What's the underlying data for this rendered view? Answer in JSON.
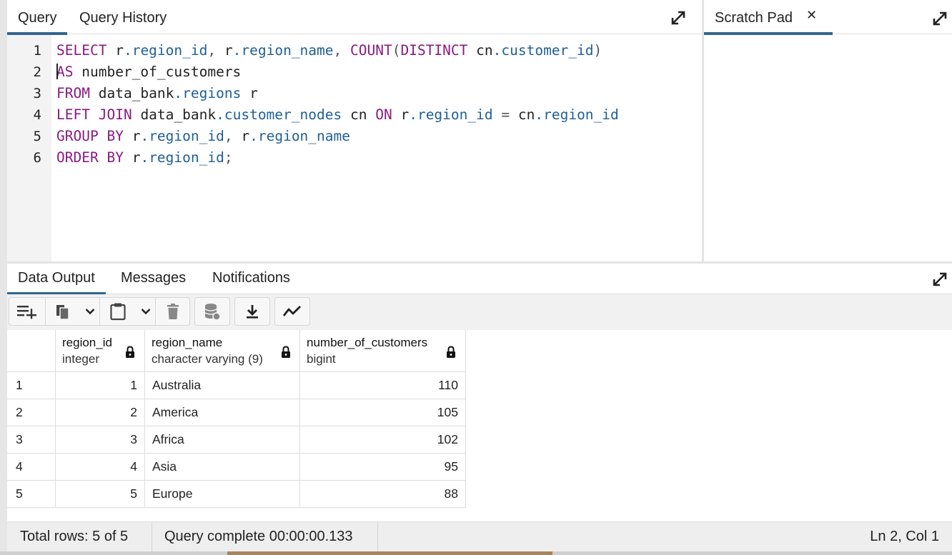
{
  "query_panel": {
    "tabs": [
      {
        "label": "Query",
        "active": true
      },
      {
        "label": "Query History",
        "active": false
      }
    ],
    "expand_icon": "expand-diagonal-icon",
    "line_numbers": [
      "1",
      "2",
      "3",
      "4",
      "5",
      "6"
    ],
    "code_lines": [
      "SELECT r.region_id, r.region_name, COUNT(DISTINCT cn.customer_id)",
      "AS number_of_customers",
      "FROM data_bank.regions r",
      "LEFT JOIN data_bank.customer_nodes cn ON r.region_id = cn.region_id",
      "GROUP BY r.region_id, r.region_name",
      "ORDER BY r.region_id;"
    ],
    "syntax_colors": {
      "keyword": "#8a1a82",
      "field": "#1f5f95",
      "text": "#222222"
    }
  },
  "scratch_pad": {
    "tab_label": "Scratch Pad",
    "close_icon": "close-icon",
    "expand_icon": "expand-diagonal-icon"
  },
  "output_panel": {
    "tabs": [
      {
        "label": "Data Output",
        "active": true
      },
      {
        "label": "Messages",
        "active": false
      },
      {
        "label": "Notifications",
        "active": false
      }
    ],
    "toolbar": [
      "add-row-icon",
      "copy-icon",
      "chevron-down-icon",
      "paste-icon",
      "chevron-down-icon",
      "delete-icon",
      "save-data-icon",
      "download-icon",
      "graph-visualiser-icon"
    ],
    "columns": [
      {
        "name": "region_id",
        "type": "integer",
        "locked": true
      },
      {
        "name": "region_name",
        "type": "character varying (9)",
        "locked": true
      },
      {
        "name": "number_of_customers",
        "type": "bigint",
        "locked": true
      }
    ],
    "rows": [
      {
        "n": "1",
        "region_id": "1",
        "region_name": "Australia",
        "number_of_customers": "110"
      },
      {
        "n": "2",
        "region_id": "2",
        "region_name": "America",
        "number_of_customers": "105"
      },
      {
        "n": "3",
        "region_id": "3",
        "region_name": "Africa",
        "number_of_customers": "102"
      },
      {
        "n": "4",
        "region_id": "4",
        "region_name": "Asia",
        "number_of_customers": "95"
      },
      {
        "n": "5",
        "region_id": "5",
        "region_name": "Europe",
        "number_of_customers": "88"
      }
    ]
  },
  "status": {
    "total_rows": "Total rows: 5 of 5",
    "query_status": "Query complete 00:00:00.133",
    "cursor_position": "Ln 2, Col 1"
  },
  "accent_color": "#326690"
}
